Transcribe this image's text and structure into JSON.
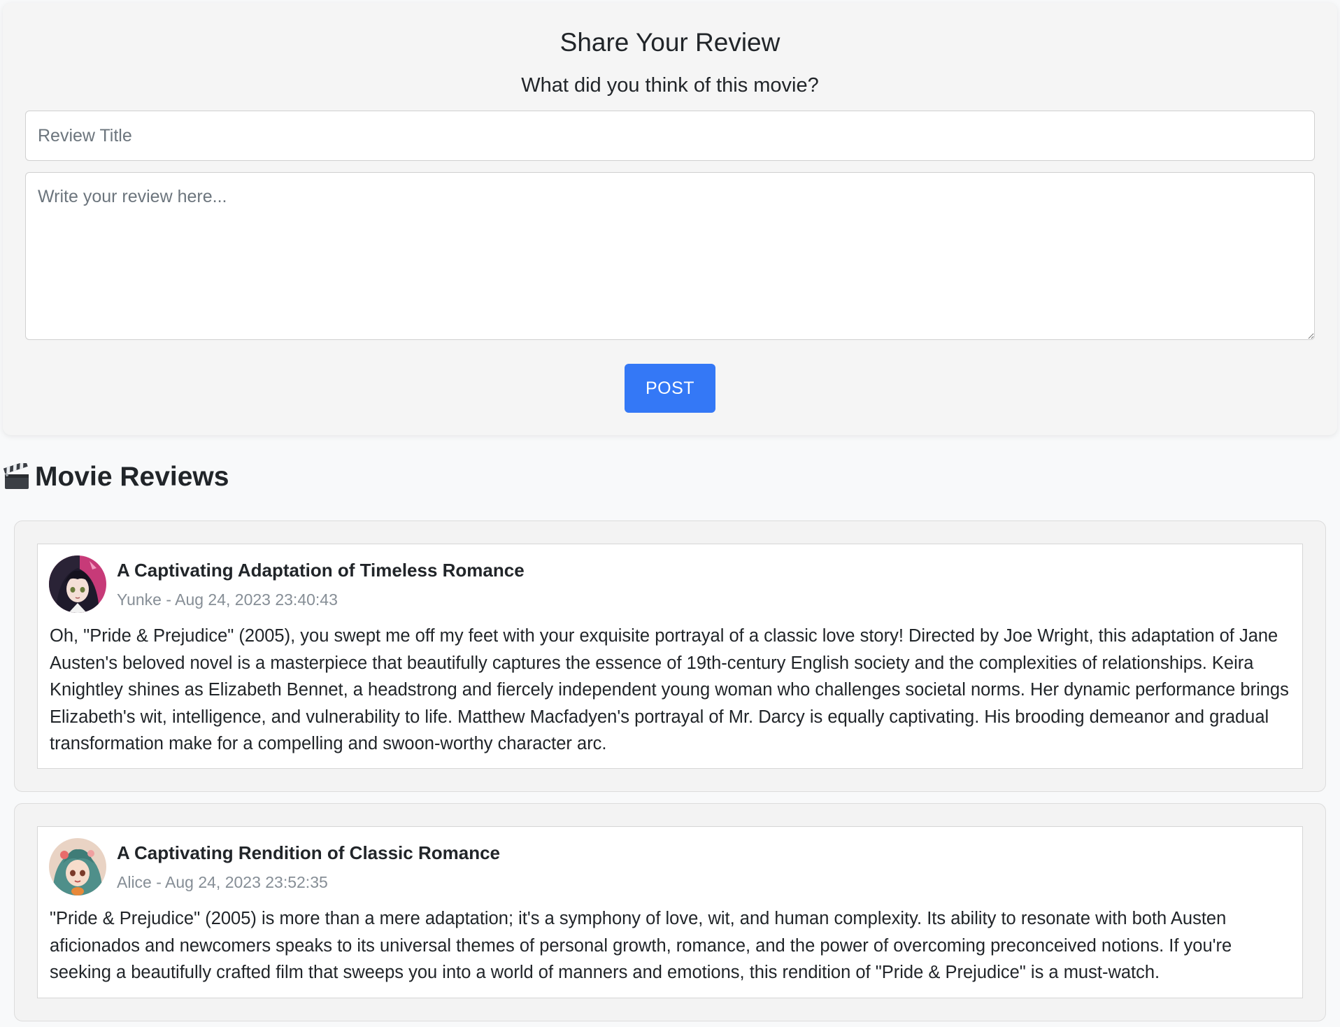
{
  "form": {
    "title": "Share Your Review",
    "subtitle": "What did you think of this movie?",
    "title_placeholder": "Review Title",
    "body_placeholder": "Write your review here...",
    "post_label": "POST",
    "accent_color": "#3478f6"
  },
  "reviews_section": {
    "icon": "clapper-board-icon",
    "heading": "Movie Reviews"
  },
  "reviews": [
    {
      "title": "A Captivating Adaptation of Timeless Romance",
      "meta": "Yunke - Aug 24, 2023 23:40:43",
      "body": "Oh, \"Pride & Prejudice\" (2005), you swept me off my feet with your exquisite portrayal of a classic love story! Directed by Joe Wright, this adaptation of Jane Austen's beloved novel is a masterpiece that beautifully captures the essence of 19th-century English society and the complexities of relationships. Keira Knightley shines as Elizabeth Bennet, a headstrong and fiercely independent young woman who challenges societal norms. Her dynamic performance brings Elizabeth's wit, intelligence, and vulnerability to life. Matthew Macfadyen's portrayal of Mr. Darcy is equally captivating. His brooding demeanor and gradual transformation make for a compelling and swoon-worthy character arc."
    },
    {
      "title": "A Captivating Rendition of Classic Romance",
      "meta": "Alice - Aug 24, 2023 23:52:35",
      "body": "\"Pride & Prejudice\" (2005) is more than a mere adaptation; it's a symphony of love, wit, and human complexity. Its ability to resonate with both Austen aficionados and newcomers speaks to its universal themes of personal growth, romance, and the power of overcoming preconceived notions. If you're seeking a beautifully crafted film that sweeps you into a world of manners and emotions, this rendition of \"Pride & Prejudice\" is a must-watch."
    }
  ]
}
